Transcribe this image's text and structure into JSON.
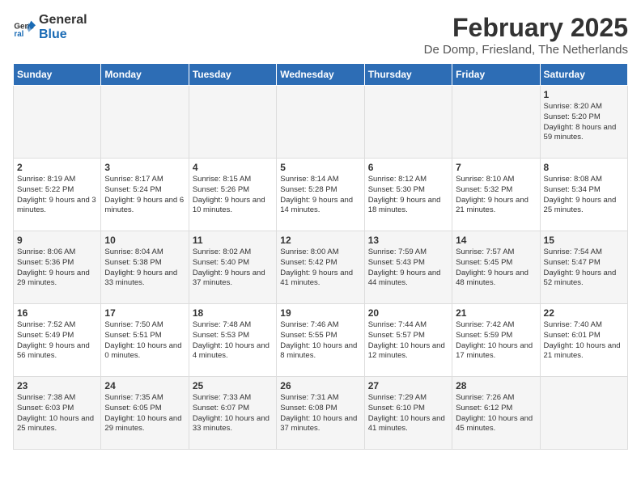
{
  "logo": {
    "line1": "General",
    "line2": "Blue"
  },
  "title": "February 2025",
  "subtitle": "De Domp, Friesland, The Netherlands",
  "days_of_week": [
    "Sunday",
    "Monday",
    "Tuesday",
    "Wednesday",
    "Thursday",
    "Friday",
    "Saturday"
  ],
  "weeks": [
    [
      {
        "day": "",
        "info": ""
      },
      {
        "day": "",
        "info": ""
      },
      {
        "day": "",
        "info": ""
      },
      {
        "day": "",
        "info": ""
      },
      {
        "day": "",
        "info": ""
      },
      {
        "day": "",
        "info": ""
      },
      {
        "day": "1",
        "info": "Sunrise: 8:20 AM\nSunset: 5:20 PM\nDaylight: 8 hours and 59 minutes."
      }
    ],
    [
      {
        "day": "2",
        "info": "Sunrise: 8:19 AM\nSunset: 5:22 PM\nDaylight: 9 hours and 3 minutes."
      },
      {
        "day": "3",
        "info": "Sunrise: 8:17 AM\nSunset: 5:24 PM\nDaylight: 9 hours and 6 minutes."
      },
      {
        "day": "4",
        "info": "Sunrise: 8:15 AM\nSunset: 5:26 PM\nDaylight: 9 hours and 10 minutes."
      },
      {
        "day": "5",
        "info": "Sunrise: 8:14 AM\nSunset: 5:28 PM\nDaylight: 9 hours and 14 minutes."
      },
      {
        "day": "6",
        "info": "Sunrise: 8:12 AM\nSunset: 5:30 PM\nDaylight: 9 hours and 18 minutes."
      },
      {
        "day": "7",
        "info": "Sunrise: 8:10 AM\nSunset: 5:32 PM\nDaylight: 9 hours and 21 minutes."
      },
      {
        "day": "8",
        "info": "Sunrise: 8:08 AM\nSunset: 5:34 PM\nDaylight: 9 hours and 25 minutes."
      }
    ],
    [
      {
        "day": "9",
        "info": "Sunrise: 8:06 AM\nSunset: 5:36 PM\nDaylight: 9 hours and 29 minutes."
      },
      {
        "day": "10",
        "info": "Sunrise: 8:04 AM\nSunset: 5:38 PM\nDaylight: 9 hours and 33 minutes."
      },
      {
        "day": "11",
        "info": "Sunrise: 8:02 AM\nSunset: 5:40 PM\nDaylight: 9 hours and 37 minutes."
      },
      {
        "day": "12",
        "info": "Sunrise: 8:00 AM\nSunset: 5:42 PM\nDaylight: 9 hours and 41 minutes."
      },
      {
        "day": "13",
        "info": "Sunrise: 7:59 AM\nSunset: 5:43 PM\nDaylight: 9 hours and 44 minutes."
      },
      {
        "day": "14",
        "info": "Sunrise: 7:57 AM\nSunset: 5:45 PM\nDaylight: 9 hours and 48 minutes."
      },
      {
        "day": "15",
        "info": "Sunrise: 7:54 AM\nSunset: 5:47 PM\nDaylight: 9 hours and 52 minutes."
      }
    ],
    [
      {
        "day": "16",
        "info": "Sunrise: 7:52 AM\nSunset: 5:49 PM\nDaylight: 9 hours and 56 minutes."
      },
      {
        "day": "17",
        "info": "Sunrise: 7:50 AM\nSunset: 5:51 PM\nDaylight: 10 hours and 0 minutes."
      },
      {
        "day": "18",
        "info": "Sunrise: 7:48 AM\nSunset: 5:53 PM\nDaylight: 10 hours and 4 minutes."
      },
      {
        "day": "19",
        "info": "Sunrise: 7:46 AM\nSunset: 5:55 PM\nDaylight: 10 hours and 8 minutes."
      },
      {
        "day": "20",
        "info": "Sunrise: 7:44 AM\nSunset: 5:57 PM\nDaylight: 10 hours and 12 minutes."
      },
      {
        "day": "21",
        "info": "Sunrise: 7:42 AM\nSunset: 5:59 PM\nDaylight: 10 hours and 17 minutes."
      },
      {
        "day": "22",
        "info": "Sunrise: 7:40 AM\nSunset: 6:01 PM\nDaylight: 10 hours and 21 minutes."
      }
    ],
    [
      {
        "day": "23",
        "info": "Sunrise: 7:38 AM\nSunset: 6:03 PM\nDaylight: 10 hours and 25 minutes."
      },
      {
        "day": "24",
        "info": "Sunrise: 7:35 AM\nSunset: 6:05 PM\nDaylight: 10 hours and 29 minutes."
      },
      {
        "day": "25",
        "info": "Sunrise: 7:33 AM\nSunset: 6:07 PM\nDaylight: 10 hours and 33 minutes."
      },
      {
        "day": "26",
        "info": "Sunrise: 7:31 AM\nSunset: 6:08 PM\nDaylight: 10 hours and 37 minutes."
      },
      {
        "day": "27",
        "info": "Sunrise: 7:29 AM\nSunset: 6:10 PM\nDaylight: 10 hours and 41 minutes."
      },
      {
        "day": "28",
        "info": "Sunrise: 7:26 AM\nSunset: 6:12 PM\nDaylight: 10 hours and 45 minutes."
      },
      {
        "day": "",
        "info": ""
      }
    ]
  ]
}
